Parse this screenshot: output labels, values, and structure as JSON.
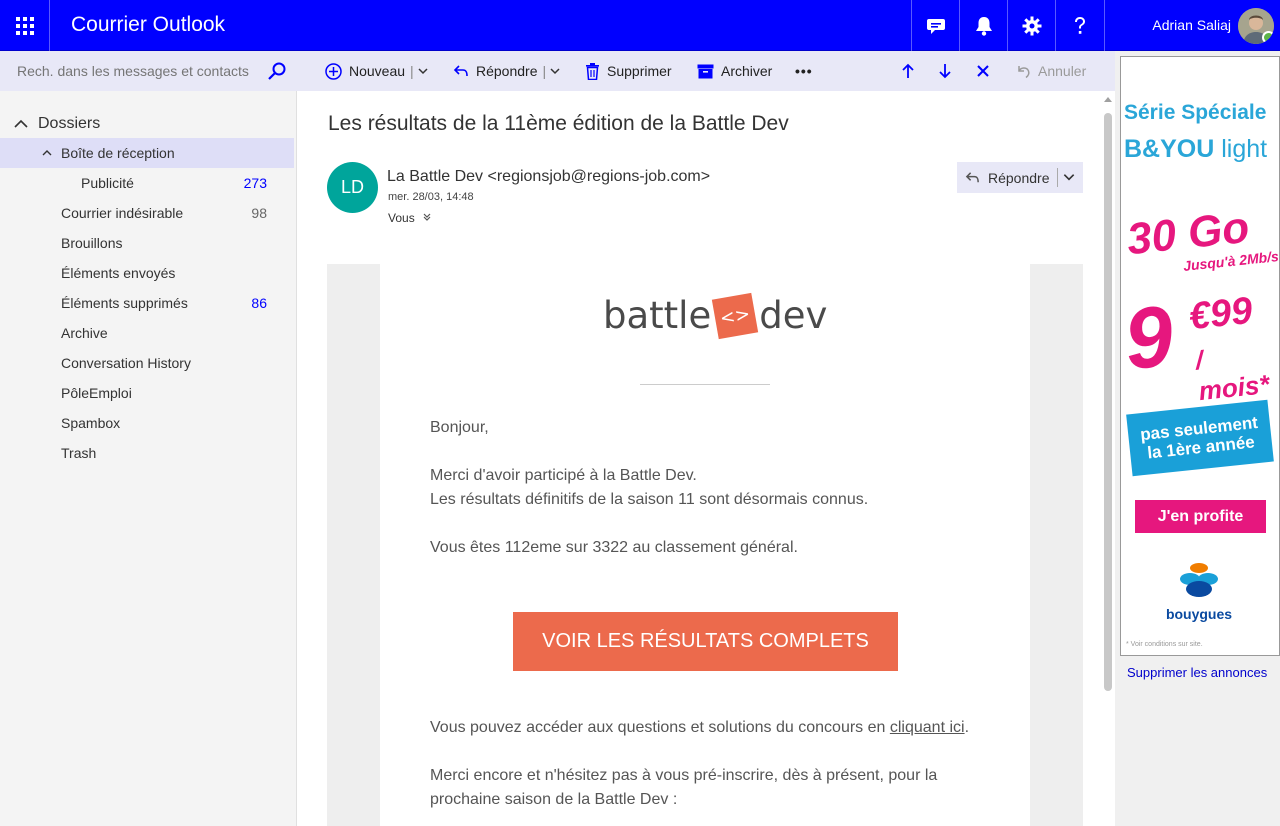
{
  "app": {
    "title": "Courrier Outlook",
    "user_name": "Adrian Saliaj"
  },
  "search": {
    "placeholder": "Rech. dans les messages et contacts"
  },
  "commands": {
    "new": "Nouveau",
    "reply": "Répondre",
    "delete": "Supprimer",
    "archive": "Archiver",
    "more": "•••",
    "undo": "Annuler"
  },
  "folders": {
    "header": "Dossiers",
    "inbox": "Boîte de réception",
    "items": [
      {
        "label": "Publicité",
        "count": "273"
      },
      {
        "label": "Courrier indésirable",
        "count": "98"
      },
      {
        "label": "Brouillons",
        "count": ""
      },
      {
        "label": "Éléments envoyés",
        "count": ""
      },
      {
        "label": "Éléments supprimés",
        "count": "86"
      },
      {
        "label": "Archive",
        "count": ""
      },
      {
        "label": "Conversation History",
        "count": ""
      },
      {
        "label": "PôleEmploi",
        "count": ""
      },
      {
        "label": "Spambox",
        "count": ""
      },
      {
        "label": "Trash",
        "count": ""
      }
    ]
  },
  "message": {
    "subject": "Les résultats de la 11ème édition de la Battle Dev",
    "sender_initials": "LD",
    "sender": "La Battle Dev <regionsjob@regions-job.com>",
    "date": "mer. 28/03, 14:48",
    "to": "Vous",
    "reply_label": "Répondre",
    "logo_left": "battle",
    "logo_mark": "<>",
    "logo_right": "dev",
    "greeting": "Bonjour,",
    "line1": "Merci d'avoir participé à la Battle Dev.",
    "line2": "Les résultats définitifs de la saison 11 sont désormais connus.",
    "line3": "Vous êtes 112eme sur 3322 au classement général.",
    "cta": "VOIR LES RÉSULTATS COMPLETS",
    "access_text": "Vous pouvez accéder aux questions et solutions du concours en ",
    "access_link": "cliquant ici",
    "access_end": ".",
    "preinscribe_1": "Merci encore et n'hésitez pas à vous pré-inscrire, dès à présent, pour la",
    "preinscribe_2": "prochaine saison de la Battle Dev :"
  },
  "ad": {
    "line1": "Série Spéciale",
    "line2_bold": "B&YOU",
    "line2_light": "light",
    "data": "30 Go",
    "speed": "Jusqu'à 2Mb/s",
    "price_main": "9",
    "price_cents": "€99",
    "price_unit": "/ mois*",
    "tag_1": "pas seulement",
    "tag_2": "la 1ère année",
    "cta": "J'en profite",
    "brand": "bouygues",
    "fine_print": "* Voir conditions sur site.",
    "remove": "Supprimer les annonces"
  },
  "colors": {
    "topbar": "#0000ff",
    "accent_button": "#ec6a4c",
    "ad_pink": "#e6177e",
    "ad_blue": "#2aa6d8",
    "avatar_teal": "#00a59b"
  }
}
